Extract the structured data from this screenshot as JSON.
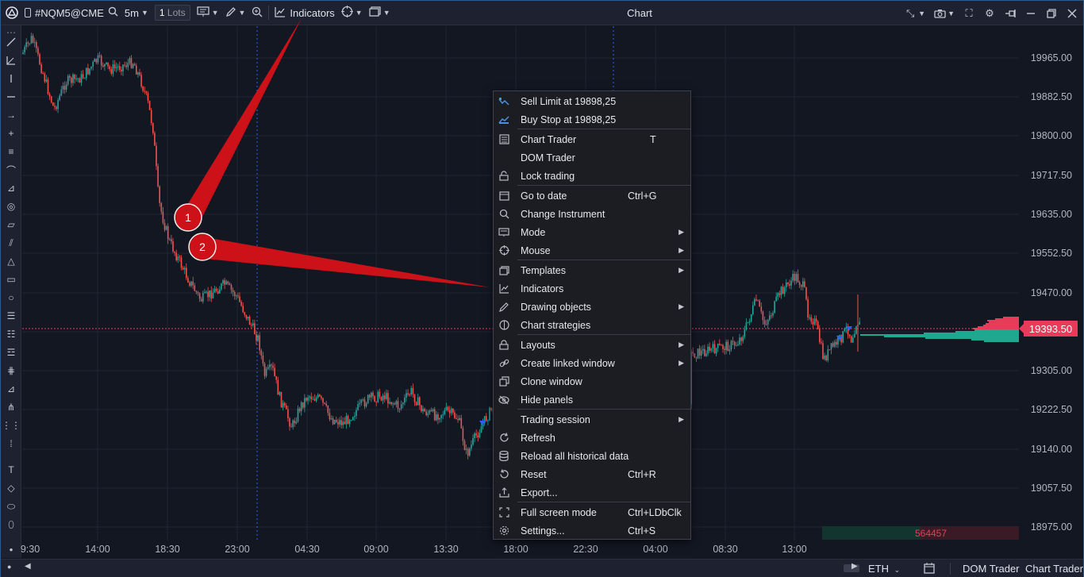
{
  "toolbar": {
    "symbol": "#NQM5@CME",
    "timeframe": "5m",
    "lots_value": "1",
    "lots_unit": "Lots",
    "indicators_label": "Indicators",
    "title": "Chart"
  },
  "price_axis": {
    "labels": [
      "19965.00",
      "19882.50",
      "19800.00",
      "19717.50",
      "19635.00",
      "19552.50",
      "19470.00",
      "19393.50",
      "19305.00",
      "19222.50",
      "19140.00",
      "19057.50",
      "18975.00"
    ],
    "last_price": "19393.50"
  },
  "time_axis": {
    "labels": [
      "9:30",
      "14:00",
      "18:30",
      "23:00",
      "04:30",
      "09:00",
      "13:30",
      "18:00",
      "22:30",
      "04:00",
      "08:30",
      "13:00"
    ]
  },
  "volume_box": "564457",
  "context_menu": {
    "items": [
      {
        "label": "Sell Limit at 19898,25",
        "shortcut": "",
        "icon": "sell-limit-icon",
        "submenu": false
      },
      {
        "label": "Buy Stop at 19898,25",
        "shortcut": "",
        "icon": "buy-stop-icon",
        "submenu": false
      },
      {
        "label": "Chart Trader",
        "shortcut": "T",
        "icon": "chart-trader-icon",
        "submenu": false
      },
      {
        "label": "DOM Trader",
        "shortcut": "",
        "icon": "",
        "submenu": false
      },
      {
        "label": "Lock trading",
        "shortcut": "",
        "icon": "lock-icon",
        "submenu": false
      },
      {
        "label": "Go to date",
        "shortcut": "Ctrl+G",
        "icon": "calendar-icon",
        "submenu": false
      },
      {
        "label": "Change Instrument",
        "shortcut": "",
        "icon": "search-icon",
        "submenu": false
      },
      {
        "label": "Mode",
        "shortcut": "",
        "icon": "mode-icon",
        "submenu": true
      },
      {
        "label": "Mouse",
        "shortcut": "",
        "icon": "crosshair-icon",
        "submenu": true
      },
      {
        "label": "Templates",
        "shortcut": "",
        "icon": "templates-icon",
        "submenu": true
      },
      {
        "label": "Indicators",
        "shortcut": "",
        "icon": "indicators-icon",
        "submenu": false
      },
      {
        "label": "Drawing objects",
        "shortcut": "",
        "icon": "pencil-icon",
        "submenu": true
      },
      {
        "label": "Chart strategies",
        "shortcut": "",
        "icon": "strategy-icon",
        "submenu": false
      },
      {
        "label": "Layouts",
        "shortcut": "",
        "icon": "layouts-lock-icon",
        "submenu": true
      },
      {
        "label": "Create linked window",
        "shortcut": "",
        "icon": "link-icon",
        "submenu": true
      },
      {
        "label": "Clone window",
        "shortcut": "",
        "icon": "clone-icon",
        "submenu": false
      },
      {
        "label": "Hide panels",
        "shortcut": "",
        "icon": "eye-off-icon",
        "submenu": false
      },
      {
        "label": "Trading session",
        "shortcut": "",
        "icon": "",
        "submenu": true
      },
      {
        "label": "Refresh",
        "shortcut": "",
        "icon": "refresh-icon",
        "submenu": false
      },
      {
        "label": "Reload all historical data",
        "shortcut": "",
        "icon": "database-icon",
        "submenu": false
      },
      {
        "label": "Reset",
        "shortcut": "Ctrl+R",
        "icon": "reset-icon",
        "submenu": false
      },
      {
        "label": "Export...",
        "shortcut": "",
        "icon": "export-icon",
        "submenu": false
      },
      {
        "label": "Full screen mode",
        "shortcut": "Ctrl+LDbClk",
        "icon": "fullscreen-icon",
        "submenu": false
      },
      {
        "label": "Settings...",
        "shortcut": "Ctrl+S",
        "icon": "gear-icon",
        "submenu": false
      }
    ]
  },
  "callouts": {
    "one": "1",
    "two": "2"
  },
  "bottom_bar": {
    "session": "ETH",
    "dom_trader": "DOM Trader",
    "chart_trader": "Chart Trader"
  },
  "colors": {
    "background": "#131722",
    "bull": "#26a69a",
    "bear": "#ef5350",
    "last_price": "#e83b5a",
    "callout": "#cc1118"
  }
}
